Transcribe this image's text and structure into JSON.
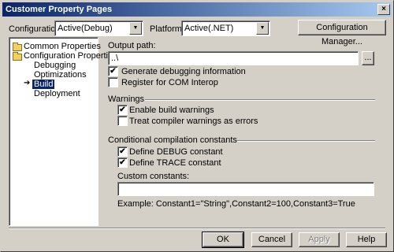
{
  "window": {
    "title": "Customer Property Pages",
    "close_glyph": "×"
  },
  "toolbar": {
    "configuration_label": "Configuration:",
    "configuration_value": "Active(Debug)",
    "platform_label": "Platform:",
    "platform_value": "Active(.NET)",
    "config_manager_button": "Configuration Manager..."
  },
  "tree": {
    "items": [
      {
        "label": "Common Properties"
      },
      {
        "label": "Configuration Properties"
      },
      {
        "label": "Debugging"
      },
      {
        "label": "Optimizations"
      },
      {
        "label": "Build"
      },
      {
        "label": "Deployment"
      }
    ]
  },
  "build": {
    "output_path_label": "Output path:",
    "output_path_value": "..\\",
    "browse_button": "...",
    "generate_debug_label": "Generate debugging information",
    "generate_debug_checked": true,
    "register_com_label": "Register for COM Interop",
    "register_com_checked": false,
    "warnings_group": "Warnings",
    "enable_warnings_label": "Enable build warnings",
    "enable_warnings_checked": true,
    "treat_errors_label": "Treat compiler warnings as errors",
    "treat_errors_checked": false,
    "conditional_group": "Conditional compilation constants",
    "define_debug_label": "Define DEBUG constant",
    "define_debug_checked": true,
    "define_trace_label": "Define TRACE constant",
    "define_trace_checked": true,
    "custom_constants_label": "Custom constants:",
    "custom_constants_value": "",
    "example_text": "Example: Constant1=\"String\",Constant2=100,Constant3=True"
  },
  "buttons": {
    "ok": "OK",
    "cancel": "Cancel",
    "apply": "Apply",
    "help": "Help"
  },
  "check_glyph": "✔",
  "icons": {
    "folder": "folder-icon",
    "arrow": "arrow-right-icon",
    "dropdown": "chevron-down-icon"
  }
}
